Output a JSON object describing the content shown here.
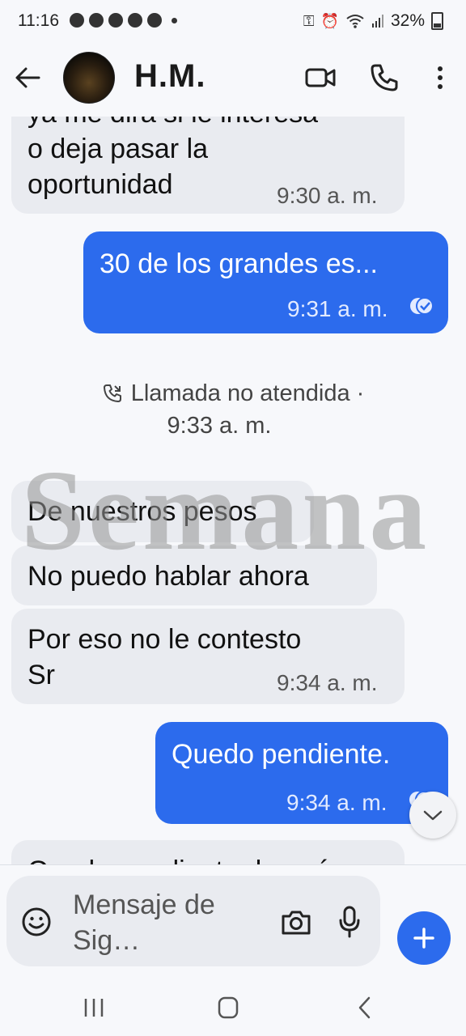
{
  "status_bar": {
    "time": "11:16",
    "battery": "32%"
  },
  "header": {
    "contact_name": "H.M."
  },
  "messages": [
    {
      "direction": "in",
      "lines": [
        "ya me dirá si le interesa",
        "o deja pasar la",
        "oportunidad"
      ],
      "time": "9:30 a. m."
    },
    {
      "direction": "out",
      "text": "30 de los grandes es...",
      "time": "9:31 a. m."
    },
    {
      "direction": "system",
      "text": "Llamada no atendida ·",
      "time": "9:33 a. m."
    },
    {
      "direction": "in",
      "text": "De nuestros pesos"
    },
    {
      "direction": "in",
      "text": "No puedo hablar ahora"
    },
    {
      "direction": "in",
      "lines": [
        "Por eso no le contesto",
        "Sr"
      ],
      "time": "9:34 a. m."
    },
    {
      "direction": "out",
      "text": "Quedo pendiente.",
      "time": "9:34 a. m."
    },
    {
      "direction": "in",
      "text": "Quedo pendiente de qué"
    }
  ],
  "watermark": "Semana",
  "composer": {
    "placeholder_line1": "Mensaje de",
    "placeholder_line2": "Sig…"
  },
  "colors": {
    "outgoing_bubble": "#2c6bed",
    "incoming_bubble": "#e9ebf0",
    "background": "#f7f8fb"
  },
  "icons": [
    "back-arrow-icon",
    "video-call-icon",
    "phone-icon",
    "more-vert-icon",
    "missed-call-icon",
    "read-receipt-icon",
    "chevron-down-icon",
    "emoji-icon",
    "camera-icon",
    "mic-icon",
    "plus-icon",
    "recent-apps-icon",
    "home-icon",
    "back-nav-icon"
  ]
}
